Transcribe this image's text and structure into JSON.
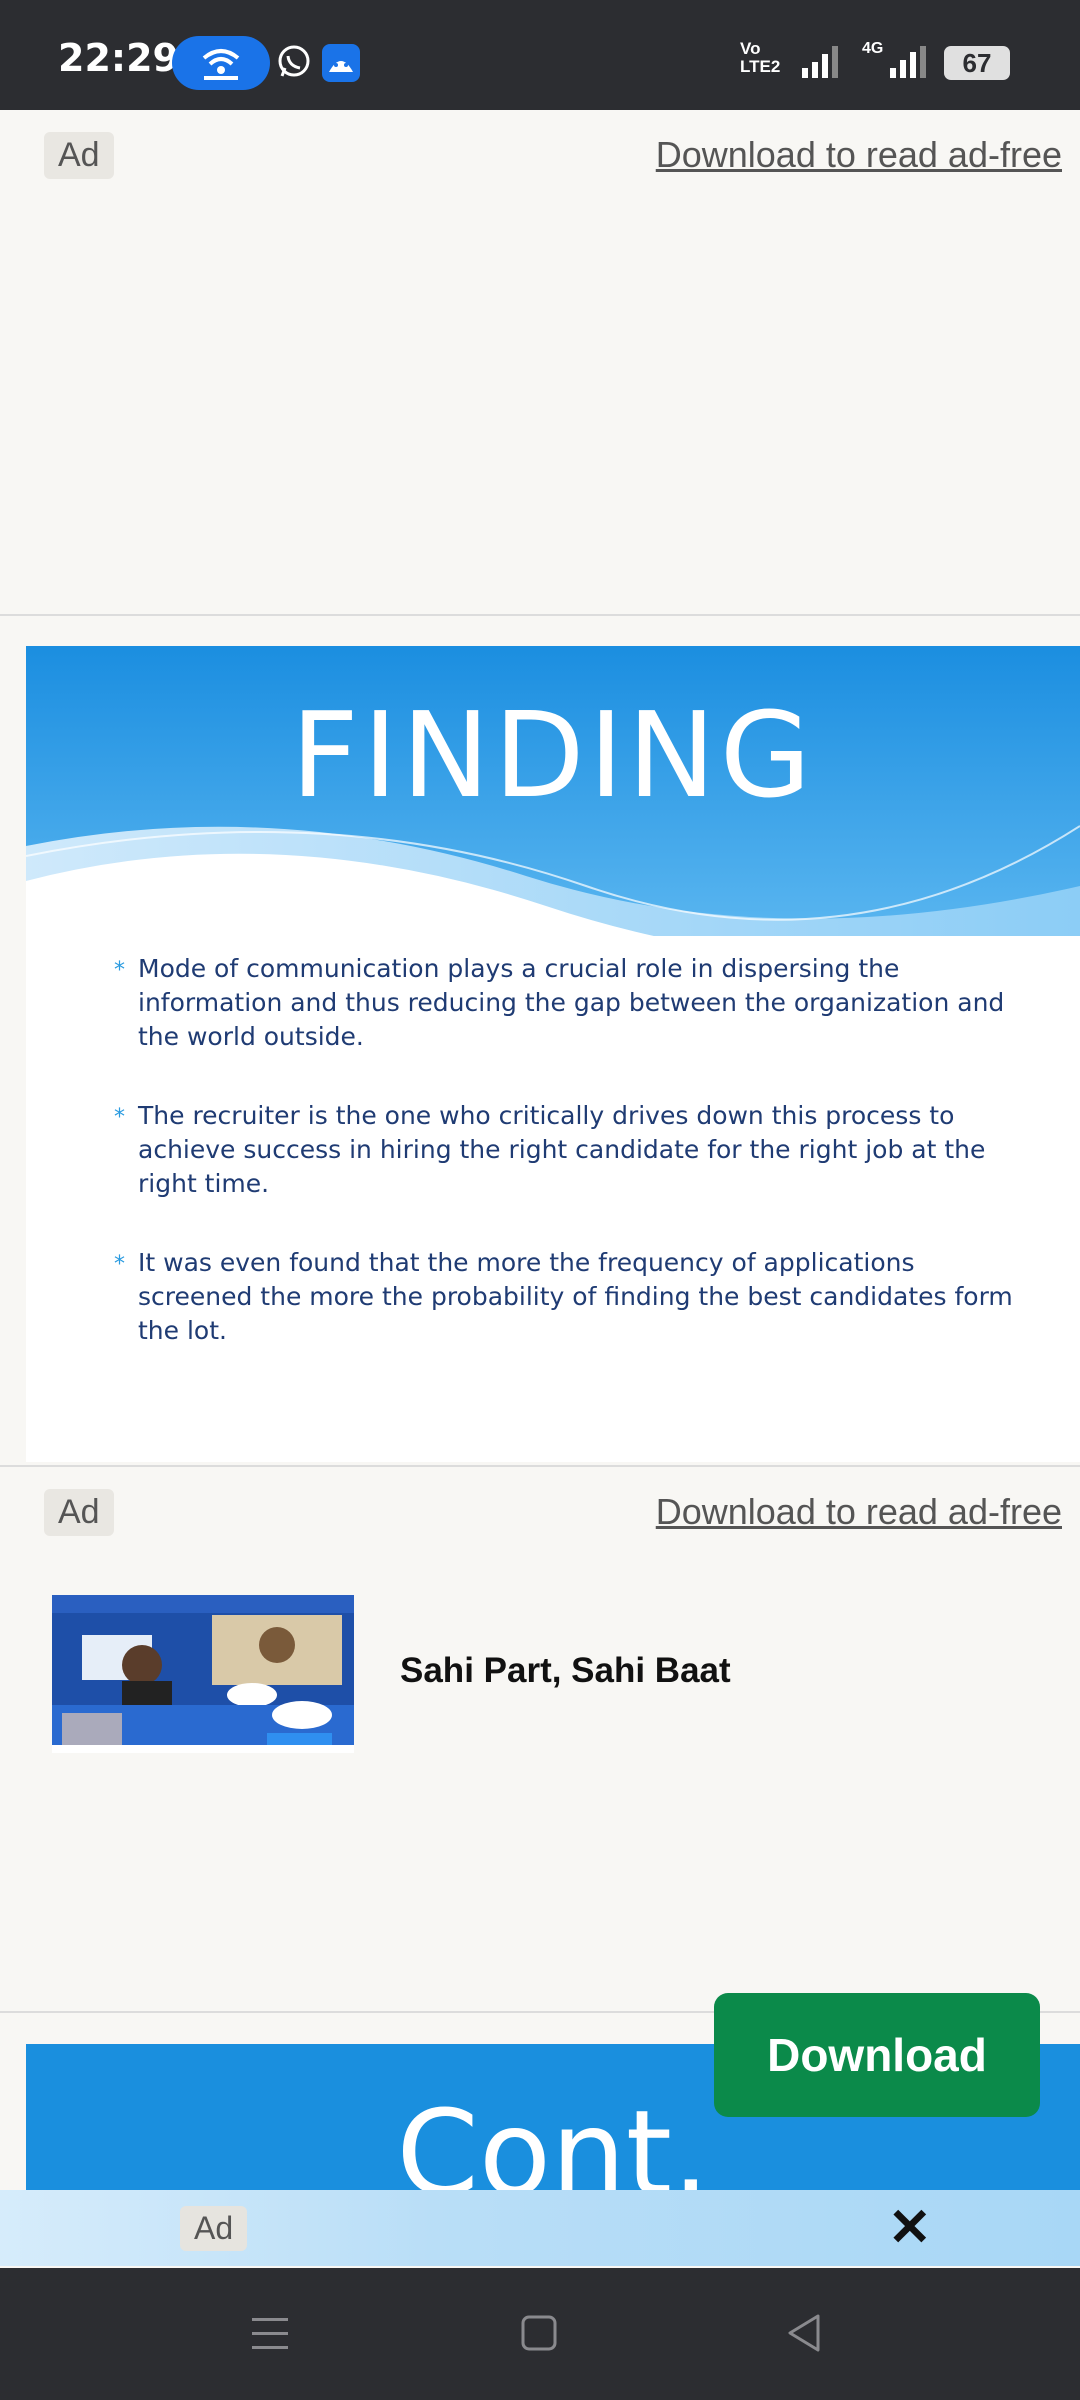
{
  "status_bar": {
    "time": "22:29",
    "volte_line1": "Vo",
    "volte_line2": "LTE2",
    "network": "4G",
    "battery": "67"
  },
  "ad_top": {
    "badge": "Ad",
    "ad_free_link": "Download to read ad-free"
  },
  "slide1": {
    "title": "FINDING",
    "bullets": [
      "Mode of communication plays a crucial role in dispersing the information and thus reducing the gap between the organization and the world outside.",
      "The recruiter is the one who critically drives down this process to achieve success in hiring the right candidate for the right job at the right time.",
      " It was even found that the more the frequency of applications screened the more the probability of finding the best candidates form the lot."
    ]
  },
  "ad_mid": {
    "badge": "Ad",
    "ad_free_link": "Download to read ad-free",
    "headline": "Sahi Part, Sahi Baat"
  },
  "slide2": {
    "title": "Cont."
  },
  "download_button": "Download",
  "bottom_ad": {
    "badge": "Ad",
    "close": "✕"
  },
  "colors": {
    "status_bar": "#2c2d31",
    "slide_blue": "#1a8fde",
    "bullet_text": "#1f3b73",
    "download_green": "#0b8a4a"
  }
}
